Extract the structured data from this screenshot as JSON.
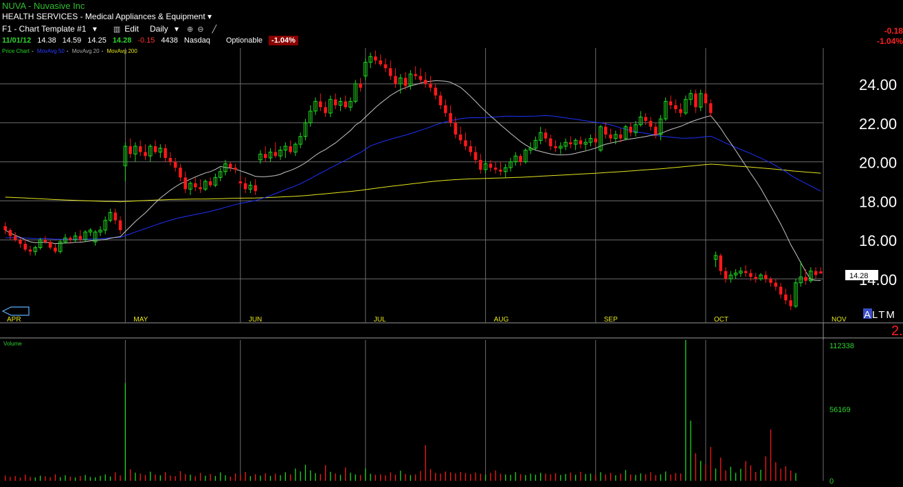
{
  "header": {
    "title": "NUVA - Nuvasive Inc",
    "sector": "HEALTH SERVICES - Medical Appliances & Equipment",
    "template": "F1 - Chart Template #1",
    "edit": "Edit",
    "interval": "Daily",
    "quote": {
      "date": "11/01/12",
      "open": "14.38",
      "high": "14.59",
      "low": "14.25",
      "close": "14.28",
      "change": "-0.15",
      "volume": "4438",
      "exchange": "Nasdaq",
      "optionable": "Optionable",
      "pct": "-1.04%"
    },
    "legend": {
      "price": "Price Chart",
      "ma50": "MovAvg 50",
      "ma20": "MovAvg 20",
      "ma200": "MovAvg 200"
    },
    "right_change": "-0.18",
    "right_pct": "-1.04%",
    "altm": "ALTM",
    "right_num": "2."
  },
  "colors": {
    "up": "#1fd81f",
    "down": "#ff1818",
    "ma20": "#c8c8c8",
    "ma50": "#1e32ff",
    "ma200": "#e6e61e",
    "grid": "#6e6e6e"
  },
  "chart_data": {
    "type": "candlestick",
    "months": [
      "APR",
      "MAY",
      "JUN",
      "JUL",
      "AUG",
      "SEP",
      "OCT",
      "NOV"
    ],
    "price_ticks": [
      "24.00",
      "22.00",
      "20.00",
      "18.00",
      "16.00",
      "14.00"
    ],
    "ylim": [
      12.2,
      26.0
    ],
    "last_price": "14.28",
    "volume_label": "Volume",
    "volume_ticks": [
      "112338",
      "56169",
      "0"
    ],
    "volume_max": 112338,
    "candles": [
      [
        16.7,
        16.9,
        16.3,
        16.5
      ],
      [
        16.5,
        16.6,
        16.0,
        16.2
      ],
      [
        16.2,
        16.4,
        15.9,
        16.0
      ],
      [
        16.0,
        16.1,
        15.6,
        15.8
      ],
      [
        15.8,
        16.0,
        15.4,
        15.5
      ],
      [
        15.5,
        15.7,
        15.2,
        15.4
      ],
      [
        15.4,
        15.7,
        15.2,
        15.6
      ],
      [
        15.6,
        16.1,
        15.5,
        16.0
      ],
      [
        16.0,
        16.2,
        15.8,
        15.9
      ],
      [
        15.9,
        16.0,
        15.5,
        15.6
      ],
      [
        15.6,
        15.8,
        15.3,
        15.4
      ],
      [
        15.4,
        16.0,
        15.3,
        15.9
      ],
      [
        15.9,
        16.3,
        15.8,
        16.1
      ],
      [
        16.1,
        16.2,
        15.8,
        16.0
      ],
      [
        16.0,
        16.4,
        15.9,
        16.2
      ],
      [
        16.2,
        16.5,
        15.9,
        16.0
      ],
      [
        16.0,
        16.5,
        15.9,
        16.4
      ],
      [
        16.4,
        16.6,
        16.2,
        16.5
      ],
      [
        15.9,
        16.5,
        15.7,
        16.4
      ],
      [
        16.4,
        16.7,
        16.2,
        16.5
      ],
      [
        16.5,
        17.2,
        16.3,
        17.0
      ],
      [
        17.0,
        17.6,
        16.9,
        17.4
      ],
      [
        17.4,
        17.6,
        16.8,
        17.0
      ],
      [
        17.0,
        17.2,
        16.3,
        16.5
      ],
      [
        19.8,
        21.0,
        19.0,
        20.8
      ],
      [
        20.8,
        21.2,
        20.2,
        20.4
      ],
      [
        20.4,
        21.0,
        20.0,
        20.8
      ],
      [
        20.8,
        21.1,
        20.3,
        20.5
      ],
      [
        20.5,
        20.9,
        20.1,
        20.3
      ],
      [
        20.3,
        20.9,
        20.0,
        20.8
      ],
      [
        20.8,
        21.1,
        20.4,
        20.5
      ],
      [
        20.5,
        20.9,
        20.2,
        20.7
      ],
      [
        20.7,
        20.9,
        20.0,
        20.2
      ],
      [
        20.2,
        20.5,
        19.8,
        20.0
      ],
      [
        20.0,
        20.2,
        19.5,
        19.7
      ],
      [
        19.7,
        19.9,
        19.0,
        19.2
      ],
      [
        19.2,
        19.5,
        18.4,
        18.6
      ],
      [
        18.6,
        19.0,
        18.3,
        18.9
      ],
      [
        18.9,
        19.2,
        18.5,
        18.7
      ],
      [
        18.7,
        19.1,
        18.4,
        18.6
      ],
      [
        18.6,
        19.1,
        18.5,
        19.0
      ],
      [
        19.0,
        19.2,
        18.7,
        18.8
      ],
      [
        18.8,
        19.4,
        18.7,
        19.2
      ],
      [
        19.2,
        19.7,
        19.0,
        19.5
      ],
      [
        19.5,
        20.1,
        19.3,
        19.9
      ],
      [
        19.9,
        20.0,
        19.5,
        19.7
      ],
      [
        19.7,
        19.9,
        19.4,
        19.6
      ],
      [
        19.0,
        19.3,
        18.7,
        18.9
      ],
      [
        18.9,
        19.2,
        18.4,
        18.6
      ],
      [
        18.6,
        19.0,
        18.4,
        18.8
      ],
      [
        18.8,
        19.1,
        18.3,
        18.5
      ],
      [
        20.1,
        20.6,
        19.9,
        20.4
      ],
      [
        20.4,
        20.8,
        20.0,
        20.2
      ],
      [
        20.2,
        20.7,
        20.0,
        20.5
      ],
      [
        20.5,
        21.0,
        20.2,
        20.3
      ],
      [
        20.3,
        20.8,
        20.1,
        20.6
      ],
      [
        20.6,
        21.0,
        20.2,
        20.8
      ],
      [
        20.8,
        21.1,
        20.4,
        20.5
      ],
      [
        20.5,
        21.0,
        20.3,
        20.9
      ],
      [
        20.9,
        21.5,
        20.7,
        21.3
      ],
      [
        21.3,
        22.2,
        21.1,
        22.0
      ],
      [
        22.0,
        22.9,
        21.8,
        22.6
      ],
      [
        22.6,
        23.3,
        22.4,
        23.1
      ],
      [
        23.1,
        23.5,
        22.6,
        22.8
      ],
      [
        22.8,
        23.1,
        22.3,
        22.5
      ],
      [
        22.5,
        23.4,
        22.3,
        23.2
      ],
      [
        23.2,
        23.5,
        22.7,
        22.9
      ],
      [
        22.9,
        23.3,
        22.6,
        23.1
      ],
      [
        23.1,
        23.4,
        22.7,
        22.8
      ],
      [
        22.8,
        23.3,
        22.6,
        23.1
      ],
      [
        23.1,
        24.2,
        23.0,
        24.0
      ],
      [
        24.0,
        24.3,
        23.6,
        23.8
      ],
      [
        24.4,
        25.3,
        24.2,
        25.1
      ],
      [
        25.1,
        25.6,
        24.8,
        25.4
      ],
      [
        25.4,
        25.7,
        25.0,
        25.2
      ],
      [
        25.2,
        25.5,
        24.9,
        25.0
      ],
      [
        25.0,
        25.3,
        24.6,
        24.8
      ],
      [
        24.8,
        25.2,
        24.2,
        24.4
      ],
      [
        24.4,
        24.8,
        23.8,
        24.0
      ],
      [
        24.0,
        24.5,
        23.5,
        24.3
      ],
      [
        24.3,
        24.6,
        23.7,
        23.9
      ],
      [
        23.9,
        24.7,
        23.7,
        24.5
      ],
      [
        24.5,
        24.9,
        24.2,
        24.4
      ],
      [
        24.4,
        24.8,
        24.0,
        24.2
      ],
      [
        24.2,
        24.6,
        23.8,
        24.0
      ],
      [
        24.0,
        24.4,
        23.6,
        23.8
      ],
      [
        23.8,
        24.0,
        23.2,
        23.4
      ],
      [
        23.4,
        23.6,
        22.7,
        22.9
      ],
      [
        22.9,
        23.2,
        22.3,
        22.5
      ],
      [
        22.5,
        22.9,
        21.8,
        22.0
      ],
      [
        22.0,
        22.3,
        21.2,
        21.4
      ],
      [
        21.4,
        21.8,
        20.9,
        21.1
      ],
      [
        21.1,
        21.5,
        20.6,
        20.8
      ],
      [
        20.8,
        21.1,
        20.3,
        20.5
      ],
      [
        20.5,
        20.8,
        19.9,
        20.1
      ],
      [
        20.1,
        20.4,
        19.4,
        19.6
      ],
      [
        19.6,
        20.1,
        19.4,
        19.9
      ],
      [
        19.9,
        20.1,
        19.5,
        19.7
      ],
      [
        19.7,
        20.0,
        19.4,
        19.6
      ],
      [
        19.6,
        20.0,
        19.3,
        19.5
      ],
      [
        19.5,
        19.9,
        19.2,
        19.7
      ],
      [
        19.7,
        20.2,
        19.5,
        20.0
      ],
      [
        20.0,
        20.5,
        19.8,
        20.3
      ],
      [
        20.3,
        20.4,
        19.8,
        20.0
      ],
      [
        20.0,
        20.7,
        19.9,
        20.6
      ],
      [
        20.6,
        21.0,
        20.4,
        20.7
      ],
      [
        20.7,
        21.3,
        20.6,
        21.1
      ],
      [
        21.1,
        21.8,
        20.9,
        21.5
      ],
      [
        21.5,
        21.7,
        21.0,
        21.2
      ],
      [
        21.2,
        21.4,
        20.6,
        20.8
      ],
      [
        20.8,
        21.1,
        20.5,
        20.7
      ],
      [
        20.7,
        21.0,
        20.4,
        20.8
      ],
      [
        20.8,
        21.2,
        20.6,
        21.0
      ],
      [
        21.0,
        21.3,
        20.7,
        20.9
      ],
      [
        20.9,
        21.2,
        20.6,
        21.1
      ],
      [
        21.1,
        21.3,
        20.7,
        20.9
      ],
      [
        20.9,
        21.2,
        20.6,
        21.0
      ],
      [
        21.0,
        21.4,
        20.8,
        21.2
      ],
      [
        21.2,
        21.5,
        20.8,
        21.0
      ],
      [
        20.6,
        21.9,
        20.5,
        21.8
      ],
      [
        21.8,
        22.0,
        21.2,
        21.4
      ],
      [
        21.4,
        21.7,
        21.0,
        21.2
      ],
      [
        21.2,
        21.6,
        20.9,
        21.4
      ],
      [
        21.4,
        21.7,
        21.0,
        21.2
      ],
      [
        21.2,
        21.9,
        21.1,
        21.8
      ],
      [
        21.8,
        22.0,
        21.3,
        21.5
      ],
      [
        21.5,
        22.1,
        21.3,
        21.9
      ],
      [
        21.9,
        22.6,
        21.8,
        22.3
      ],
      [
        22.3,
        22.5,
        21.9,
        22.1
      ],
      [
        22.1,
        22.3,
        21.6,
        21.8
      ],
      [
        21.8,
        22.0,
        21.2,
        21.4
      ],
      [
        21.4,
        22.4,
        21.1,
        22.2
      ],
      [
        22.2,
        23.3,
        22.1,
        23.1
      ],
      [
        23.1,
        23.4,
        22.7,
        22.9
      ],
      [
        22.9,
        23.2,
        22.5,
        22.7
      ],
      [
        22.7,
        23.0,
        22.3,
        22.5
      ],
      [
        22.5,
        23.4,
        22.4,
        23.2
      ],
      [
        23.2,
        23.7,
        22.9,
        23.5
      ],
      [
        23.5,
        23.7,
        22.5,
        22.8
      ],
      [
        22.8,
        23.7,
        22.6,
        23.5
      ],
      [
        23.5,
        23.7,
        22.8,
        23.0
      ],
      [
        23.0,
        23.2,
        22.3,
        22.5
      ],
      [
        15.0,
        15.4,
        14.6,
        15.2
      ],
      [
        15.2,
        15.3,
        14.2,
        14.4
      ],
      [
        14.4,
        14.6,
        13.8,
        14.0
      ],
      [
        14.0,
        14.4,
        13.8,
        14.2
      ],
      [
        14.2,
        14.5,
        14.0,
        14.3
      ],
      [
        14.3,
        14.6,
        14.1,
        14.4
      ],
      [
        14.4,
        14.7,
        14.1,
        14.3
      ],
      [
        14.3,
        14.5,
        13.9,
        14.1
      ],
      [
        14.1,
        14.3,
        13.8,
        14.0
      ],
      [
        14.0,
        14.3,
        13.9,
        14.2
      ],
      [
        14.2,
        14.4,
        13.8,
        14.0
      ],
      [
        14.0,
        14.1,
        13.6,
        13.8
      ],
      [
        13.8,
        14.0,
        13.4,
        13.6
      ],
      [
        13.6,
        13.8,
        13.0,
        13.2
      ],
      [
        13.2,
        13.5,
        12.7,
        12.9
      ],
      [
        12.9,
        13.2,
        12.4,
        12.6
      ],
      [
        12.6,
        14.0,
        12.5,
        13.8
      ],
      [
        13.8,
        14.9,
        13.6,
        14.1
      ],
      [
        14.1,
        14.5,
        13.7,
        13.9
      ],
      [
        13.9,
        14.6,
        13.8,
        14.4
      ],
      [
        14.4,
        14.6,
        14.0,
        14.2
      ],
      [
        14.38,
        14.59,
        14.25,
        14.28
      ]
    ],
    "volumes": [
      4200,
      3100,
      3800,
      2600,
      4900,
      3200,
      2800,
      4100,
      3600,
      2900,
      5200,
      3000,
      4400,
      3300,
      2700,
      3900,
      4600,
      3100,
      2800,
      4000,
      5100,
      3500,
      6800,
      4300,
      78000,
      9200,
      6500,
      5800,
      4700,
      7300,
      5100,
      4400,
      6900,
      4200,
      3800,
      7700,
      5400,
      4900,
      3600,
      6300,
      4100,
      5500,
      3900,
      6700,
      4500,
      3400,
      5900,
      4800,
      7100,
      3700,
      5300,
      4200,
      6100,
      3900,
      5700,
      4500,
      6800,
      5200,
      9800,
      7500,
      12800,
      8400,
      6100,
      5400,
      12500,
      7200,
      5900,
      4800,
      10600,
      6400,
      5100,
      4700,
      9900,
      5600,
      4800,
      5200,
      4400,
      6700,
      4900,
      8100,
      5500,
      4600,
      5100,
      7800,
      28500,
      9400,
      6300,
      5800,
      7400,
      6800,
      5900,
      7100,
      6200,
      5400,
      6600,
      5700,
      4900,
      6300,
      8200,
      5600,
      5100,
      4800,
      6900,
      5300,
      4600,
      5700,
      4900,
      6400,
      5800,
      5200,
      6100,
      4700,
      5500,
      6600,
      4800,
      7200,
      5400,
      5800,
      4500,
      6900,
      5100,
      6300,
      4400,
      5700,
      8600,
      5200,
      4700,
      5900,
      5300,
      6800,
      4600,
      5200,
      7400,
      5000,
      6200,
      5800,
      112338,
      48000,
      22000,
      16000,
      13000,
      27000,
      9800,
      18500,
      8200,
      11200,
      6400,
      9600,
      15800,
      12400,
      7100,
      8800,
      19500,
      41000,
      14800,
      9700,
      11600,
      8200,
      6200
    ]
  }
}
